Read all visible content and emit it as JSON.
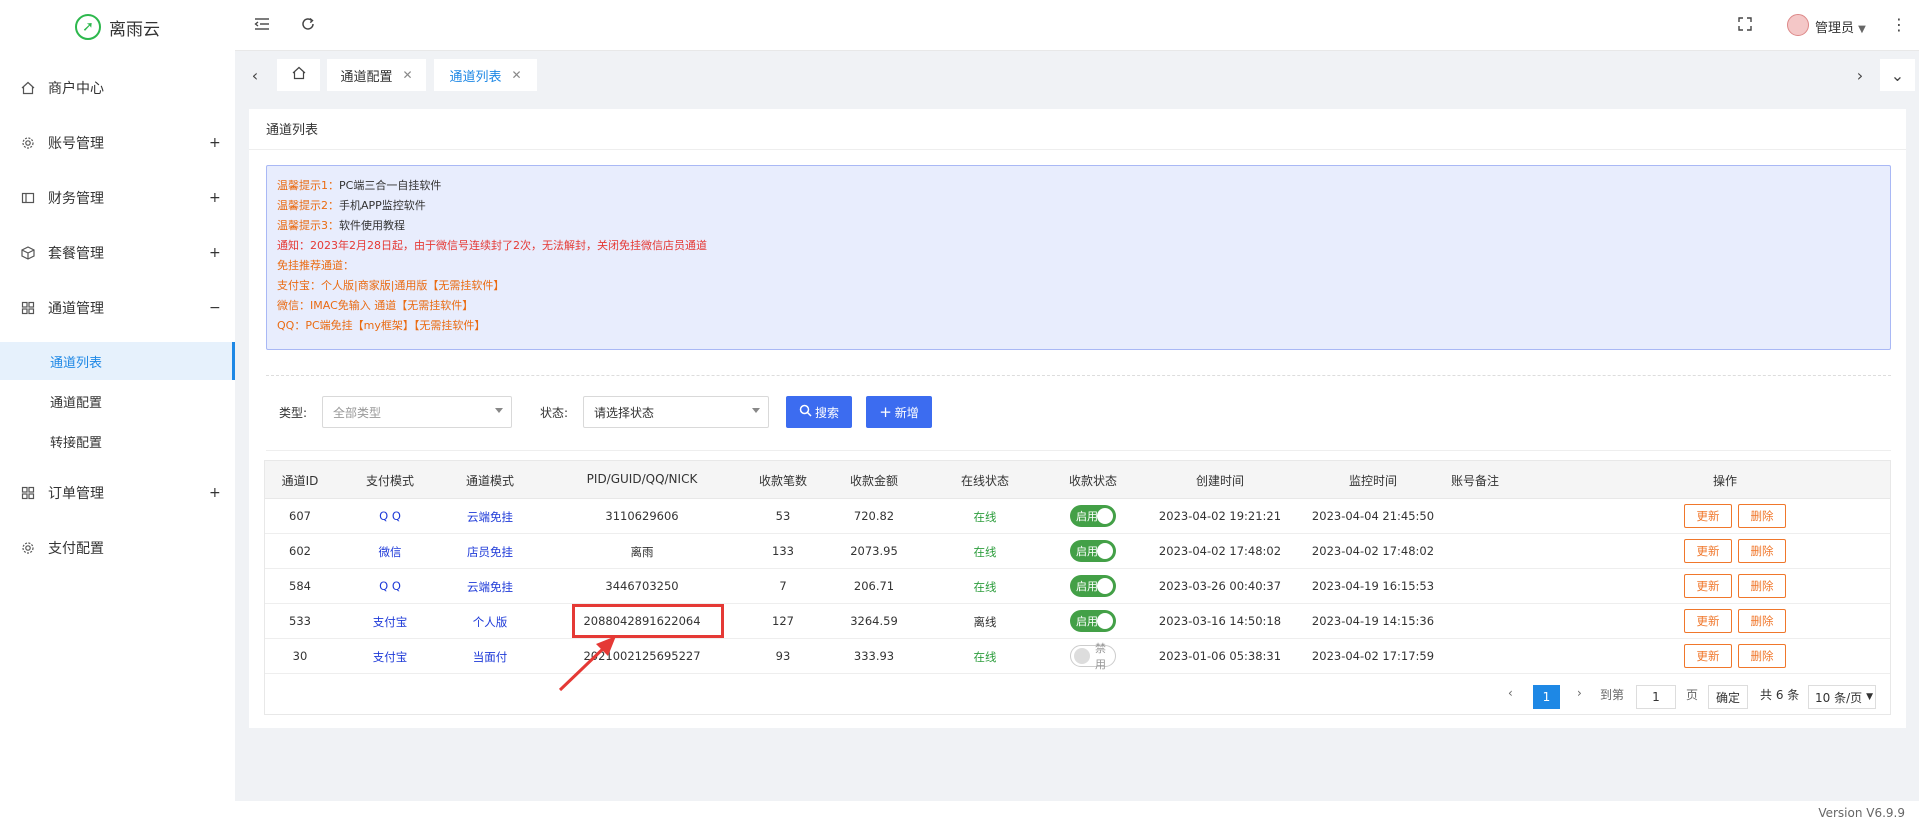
{
  "app": {
    "name": "离雨云"
  },
  "sidebar": {
    "items": [
      {
        "label": "商户中心",
        "icon": "home-icon",
        "sign": ""
      },
      {
        "label": "账号管理",
        "icon": "gear-icon",
        "sign": "+"
      },
      {
        "label": "财务管理",
        "icon": "wallet-icon",
        "sign": "+"
      },
      {
        "label": "套餐管理",
        "icon": "cube-icon",
        "sign": "+"
      },
      {
        "label": "通道管理",
        "icon": "grid-icon",
        "sign": "−"
      },
      {
        "label": "订单管理",
        "icon": "grid-icon",
        "sign": "+"
      },
      {
        "label": "支付配置",
        "icon": "gear-icon",
        "sign": ""
      }
    ],
    "subitems": [
      {
        "label": "通道列表",
        "active": true
      },
      {
        "label": "通道配置",
        "active": false
      },
      {
        "label": "转接配置",
        "active": false
      }
    ]
  },
  "topbar": {
    "user": "管理员"
  },
  "tabs": [
    {
      "label": "通道配置",
      "active": false
    },
    {
      "label": "通道列表",
      "active": true
    }
  ],
  "panel": {
    "title": "通道列表"
  },
  "notice": [
    {
      "prefix": "温馨提示1：",
      "text": "PC端三合一自挂软件"
    },
    {
      "prefix": "温馨提示2：",
      "text": "手机APP监控软件"
    },
    {
      "prefix": "温馨提示3：",
      "text": "软件使用教程"
    },
    {
      "prefix": "",
      "text": "通知：2023年2月28日起，由于微信号连续封了2次，无法解封，关闭免挂微信店员通道"
    },
    {
      "prefix": "",
      "text": "免挂推荐通道："
    },
    {
      "prefix": "",
      "text": "支付宝：个人版|商家版|通用版【无需挂软件】"
    },
    {
      "prefix": "",
      "text": "微信：IMAC免输入 通道【无需挂软件】"
    },
    {
      "prefix": "",
      "text": "QQ：PC端免挂【my框架】【无需挂软件】"
    }
  ],
  "filters": {
    "type_label": "类型:",
    "type_placeholder": "全部类型",
    "status_label": "状态:",
    "status_placeholder": "请选择状态",
    "search_btn": "搜索",
    "add_btn": "新增"
  },
  "table": {
    "headers": [
      "通道ID",
      "支付模式",
      "通道模式",
      "PID/GUID/QQ/NICK",
      "收款笔数",
      "收款金额",
      "在线状态",
      "收款状态",
      "创建时间",
      "监控时间",
      "账号备注",
      "操作"
    ],
    "rows": [
      {
        "id": "607",
        "pay": "Q Q",
        "mode": "云端免挂",
        "pid": "3110629606",
        "count": "53",
        "amount": "720.82",
        "online": "在线",
        "status": "启用",
        "enabled": true,
        "created": "2023-04-02 19:21:21",
        "monitor": "2023-04-04 21:45:50",
        "remark": ""
      },
      {
        "id": "602",
        "pay": "微信",
        "mode": "店员免挂",
        "pid": "离雨",
        "count": "133",
        "amount": "2073.95",
        "online": "在线",
        "status": "启用",
        "enabled": true,
        "created": "2023-04-02 17:48:02",
        "monitor": "2023-04-02 17:48:02",
        "remark": ""
      },
      {
        "id": "584",
        "pay": "Q Q",
        "mode": "云端免挂",
        "pid": "3446703250",
        "count": "7",
        "amount": "206.71",
        "online": "在线",
        "status": "启用",
        "enabled": true,
        "created": "2023-03-26 00:40:37",
        "monitor": "2023-04-19 16:15:53",
        "remark": ""
      },
      {
        "id": "533",
        "pay": "支付宝",
        "mode": "个人版",
        "pid": "2088042891622064",
        "count": "127",
        "amount": "3264.59",
        "online": "离线",
        "status": "启用",
        "enabled": true,
        "created": "2023-03-16 14:50:18",
        "monitor": "2023-04-19 14:15:36",
        "remark": ""
      },
      {
        "id": "30",
        "pay": "支付宝",
        "mode": "当面付",
        "pid": "2021002125695227",
        "count": "93",
        "amount": "333.93",
        "online": "在线",
        "status": "禁用",
        "enabled": false,
        "created": "2023-01-06 05:38:31",
        "monitor": "2023-04-02 17:17:59",
        "remark": ""
      }
    ],
    "update_btn": "更新",
    "delete_btn": "删除"
  },
  "pagination": {
    "current": "1",
    "goto_label": "到第",
    "page_input": "1",
    "page_unit": "页",
    "confirm": "确定",
    "total": "共 6 条",
    "per_page": "10 条/页"
  },
  "footer": {
    "version": "Version V6.9.9"
  },
  "colors": {
    "accent": "#1e88e5",
    "primary_btn": "#3c6cf0",
    "toggle_on": "#43a047",
    "offline": "#e53935",
    "online": "#2e9e3e",
    "op_btn": "#f0772b"
  }
}
